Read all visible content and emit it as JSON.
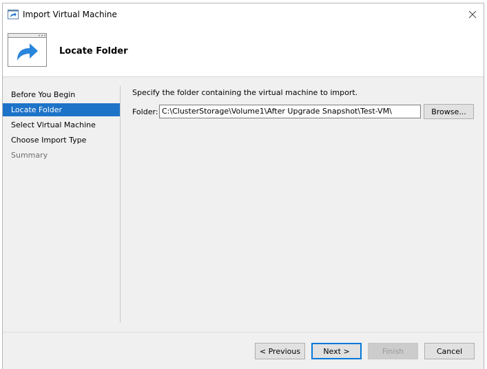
{
  "window": {
    "title": "Import Virtual Machine",
    "close_icon": "close-icon"
  },
  "header": {
    "title": "Locate Folder",
    "icon": "import-arrow-icon"
  },
  "nav": {
    "items": [
      {
        "label": "Before You Begin",
        "state": "normal"
      },
      {
        "label": "Locate Folder",
        "state": "active"
      },
      {
        "label": "Select Virtual Machine",
        "state": "normal"
      },
      {
        "label": "Choose Import Type",
        "state": "normal"
      },
      {
        "label": "Summary",
        "state": "disabled"
      }
    ]
  },
  "content": {
    "description": "Specify the folder containing the virtual machine to import.",
    "folder_label": "Folder:",
    "folder_value": "C:\\ClusterStorage\\Volume1\\After Upgrade Snapshot\\Test-VM\\",
    "browse_label": "Browse..."
  },
  "buttons": {
    "previous": "< Previous",
    "next": "Next >",
    "finish": "Finish",
    "cancel": "Cancel"
  },
  "colors": {
    "selection": "#1d73c8",
    "default_button_border": "#0078d7"
  }
}
